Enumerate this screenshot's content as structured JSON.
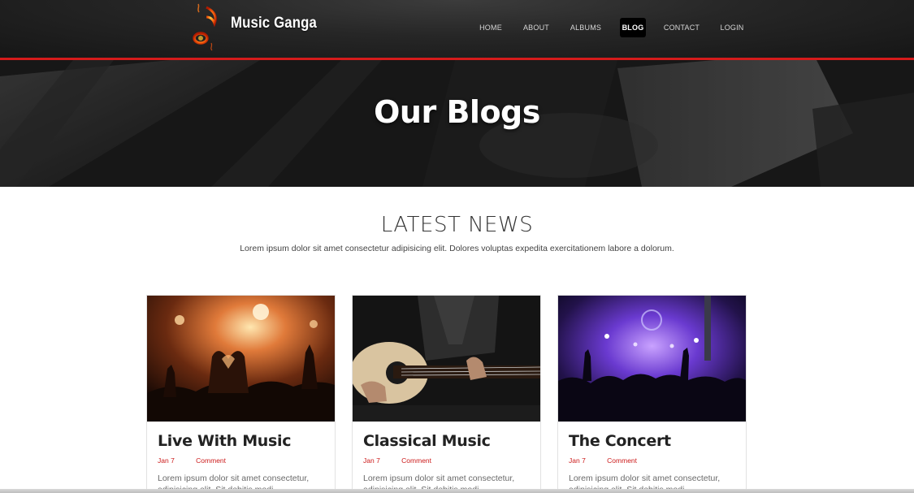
{
  "site": {
    "brand": "Music Ganga",
    "logo_icon": "music-note-flame-icon"
  },
  "nav": {
    "items": [
      {
        "label": "HOME"
      },
      {
        "label": "ABOUT"
      },
      {
        "label": "ALBUMS"
      },
      {
        "label": "BLOG"
      },
      {
        "label": "CONTACT"
      },
      {
        "label": "LOGIN"
      }
    ],
    "active": "BLOG"
  },
  "hero": {
    "title": "Our Blogs"
  },
  "news": {
    "title": "LATEST NEWS",
    "subtitle": "Lorem ipsum dolor sit amet consectetur adipisicing elit. Dolores voluptas expedita exercitationem labore a dolorum."
  },
  "cards": [
    {
      "title": "Live With Music",
      "date": "Jan 7",
      "comment": "Comment",
      "text": "Lorem ipsum dolor sit amet consectetur, adipisicing elit. Sit debitis modi",
      "image": "concert-crowd-hands-heart"
    },
    {
      "title": "Classical Music",
      "date": "Jan 7",
      "comment": "Comment",
      "text": "Lorem ipsum dolor sit amet consectetur, adipisicing elit. Sit debitis modi",
      "image": "man-playing-acoustic-guitar"
    },
    {
      "title": "The Concert",
      "date": "Jan 7",
      "comment": "Comment",
      "text": "Lorem ipsum dolor sit amet consectetur, adipisicing elit. Sit debitis modi",
      "image": "purple-stage-lights-crowd"
    }
  ],
  "colors": {
    "accent_red": "#d51b1b",
    "header_dark": "#262626",
    "meta_red": "#cc1b1b"
  }
}
